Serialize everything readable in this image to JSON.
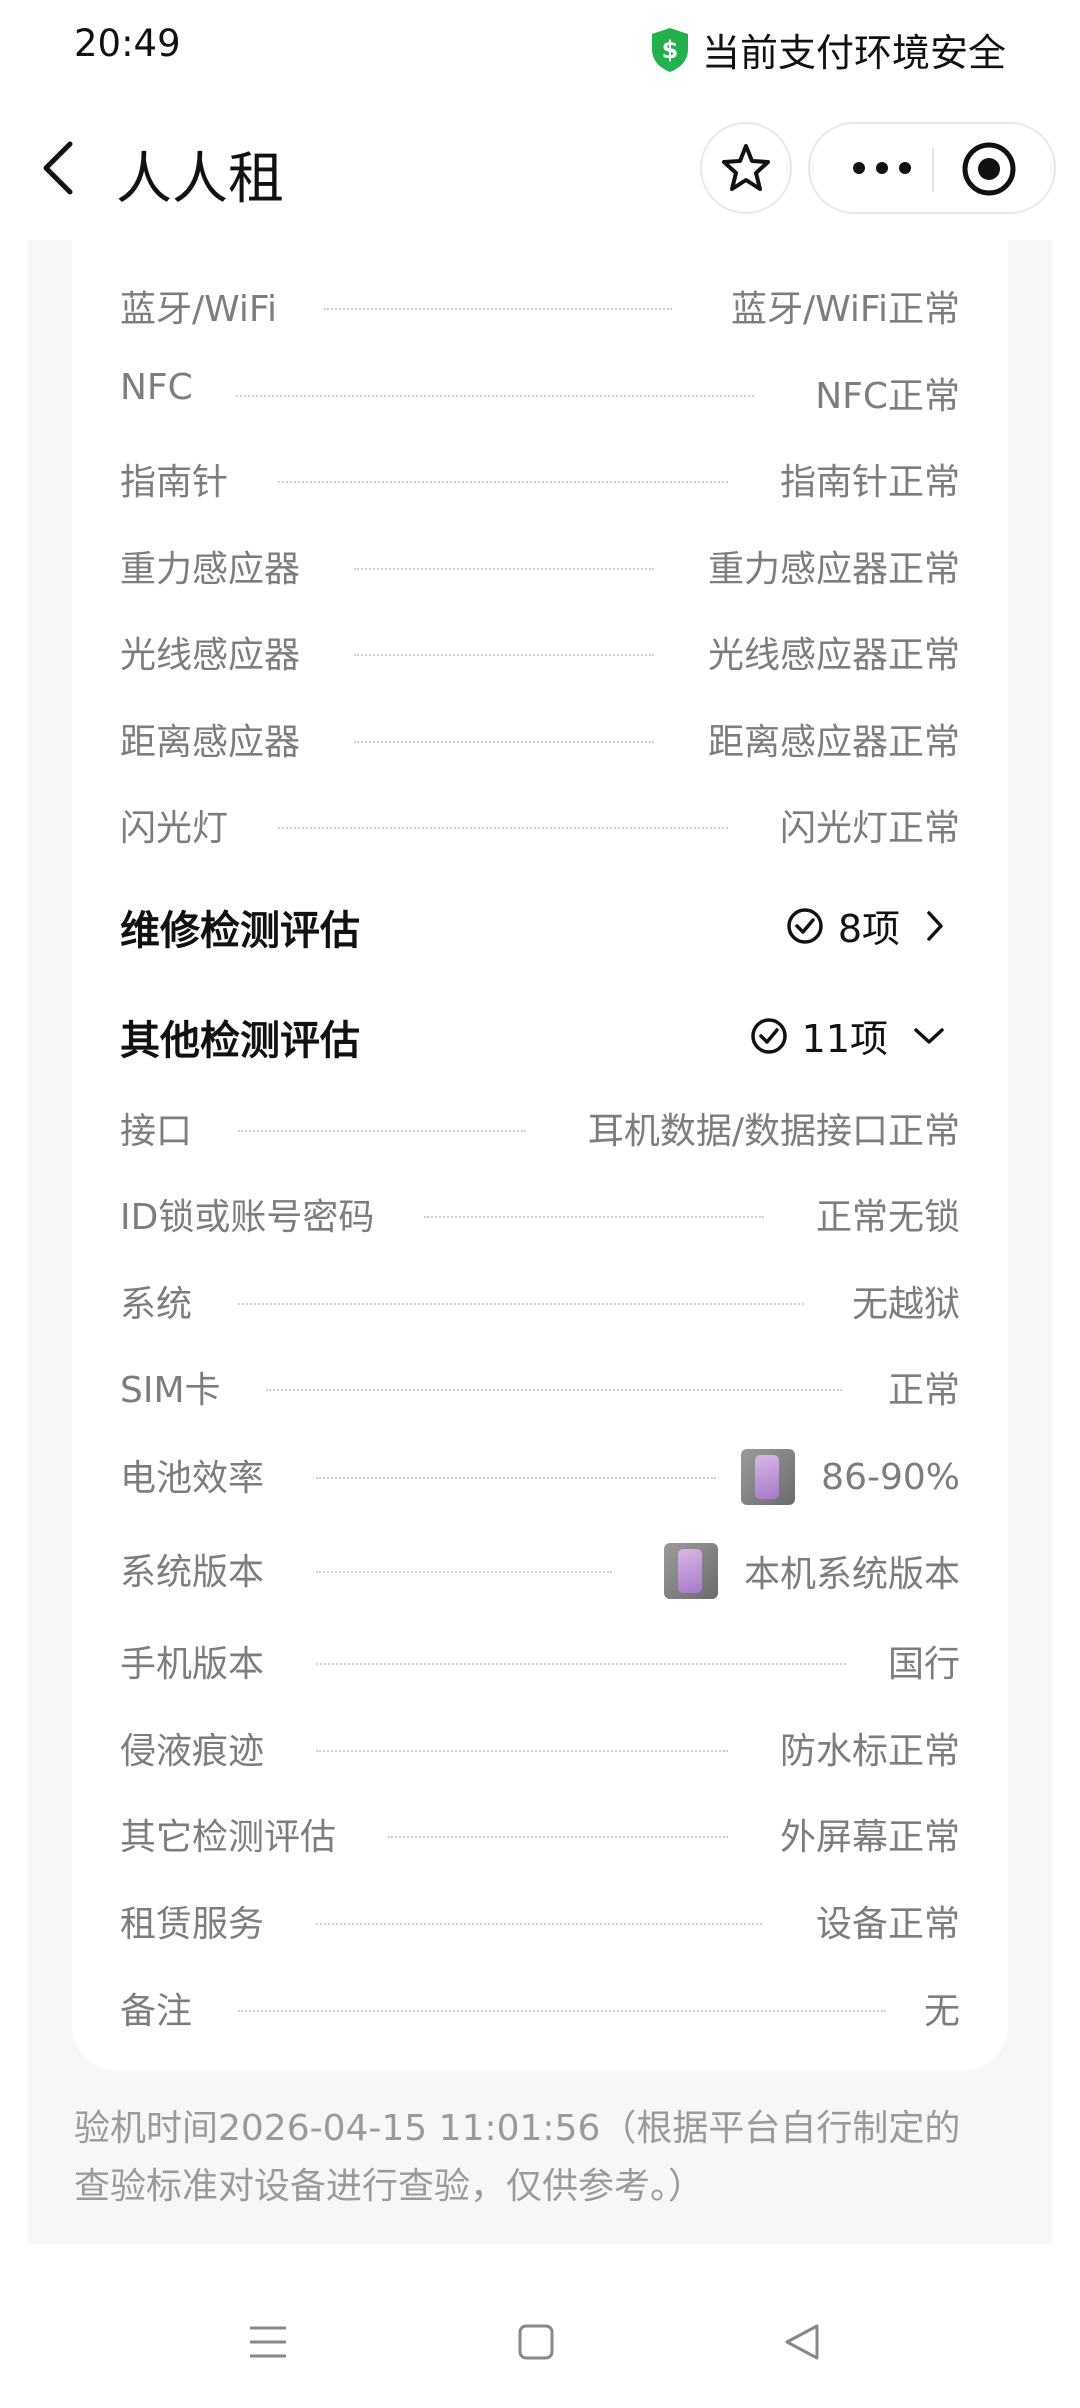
{
  "status": {
    "time": "20:49",
    "secure_text": "当前支付环境安全"
  },
  "nav": {
    "title": "人人租"
  },
  "top_rows": [
    {
      "label": "蓝牙/WiFi",
      "value": "蓝牙/WiFi正常"
    },
    {
      "label": "NFC",
      "value": "NFC正常"
    },
    {
      "label": "指南针",
      "value": "指南针正常"
    },
    {
      "label": "重力感应器",
      "value": "重力感应器正常"
    },
    {
      "label": "光线感应器",
      "value": "光线感应器正常"
    },
    {
      "label": "距离感应器",
      "value": "距离感应器正常"
    },
    {
      "label": "闪光灯",
      "value": "闪光灯正常"
    }
  ],
  "sections": {
    "repair": {
      "title": "维修检测评估",
      "count": "8项"
    },
    "other": {
      "title": "其他检测评估",
      "count": "11项"
    }
  },
  "other_rows": [
    {
      "label": "接口",
      "value": "耳机数据/数据接口正常"
    },
    {
      "label": "ID锁或账号密码",
      "value": "正常无锁"
    },
    {
      "label": "系统",
      "value": "无越狱"
    },
    {
      "label": "SIM卡",
      "value": "正常"
    },
    {
      "label": "电池效率",
      "value": "86-90%",
      "has_image": true
    },
    {
      "label": "系统版本",
      "value": "本机系统版本",
      "has_image": true
    },
    {
      "label": "手机版本",
      "value": "国行"
    },
    {
      "label": "侵液痕迹",
      "value": "防水标正常"
    },
    {
      "label": "其它检测评估",
      "value": "外屏幕正常"
    },
    {
      "label": "租赁服务",
      "value": "设备正常"
    },
    {
      "label": "备注",
      "value": "无"
    }
  ],
  "footnote": "验机时间2026-04-15 11:01:56（根据平台自行制定的查验标准对设备进行查验，仅供参考。）",
  "icons": {
    "shield": "shield-dollar-icon",
    "back": "chevron-left-icon",
    "star": "star-icon",
    "more": "more-dots-icon",
    "record": "record-icon",
    "check": "check-circle-icon",
    "chevron_right": "chevron-right-icon",
    "chevron_down": "chevron-down-icon",
    "menu": "menu-icon",
    "home": "home-square-icon",
    "back_triangle": "back-triangle-icon"
  },
  "colors": {
    "shield": "#22b14c",
    "text_dark": "#111111",
    "text_gray": "#7d7d7d",
    "page_gray": "#f7f7f7"
  }
}
